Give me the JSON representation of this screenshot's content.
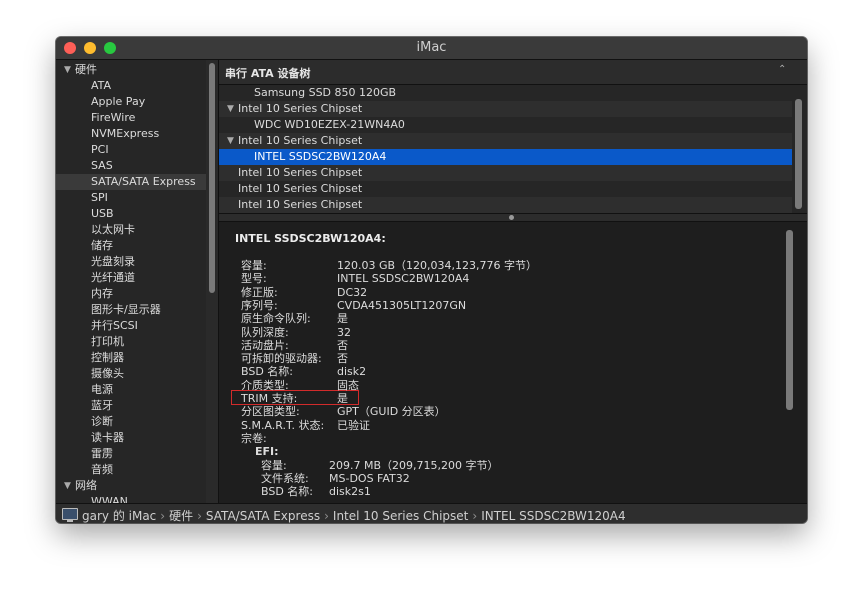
{
  "window": {
    "title": "iMac"
  },
  "sidebar": {
    "groups": [
      {
        "label": "硬件",
        "expanded": true
      },
      {
        "label": "网络",
        "expanded": true
      }
    ],
    "items": [
      "ATA",
      "Apple Pay",
      "FireWire",
      "NVMExpress",
      "PCI",
      "SAS",
      "SATA/SATA Express",
      "SPI",
      "USB",
      "以太网卡",
      "储存",
      "光盘刻录",
      "光纤通道",
      "内存",
      "图形卡/显示器",
      "并行SCSI",
      "打印机",
      "控制器",
      "摄像头",
      "电源",
      "蓝牙",
      "诊断",
      "读卡器",
      "雷雳",
      "音频"
    ],
    "network_items": [
      "WWAN"
    ],
    "selected": "SATA/SATA Express"
  },
  "tree": {
    "header": "串行 ATA 设备树",
    "rows": [
      {
        "label": "Samsung SSD 850 120GB",
        "level": 1,
        "disclosure": false
      },
      {
        "label": "Intel 10 Series Chipset",
        "level": 0,
        "disclosure": true
      },
      {
        "label": "WDC WD10EZEX-21WN4A0",
        "level": 1,
        "disclosure": false
      },
      {
        "label": "Intel 10 Series Chipset",
        "level": 0,
        "disclosure": true
      },
      {
        "label": "INTEL SSDSC2BW120A4",
        "level": 1,
        "disclosure": false,
        "selected": true
      },
      {
        "label": "Intel 10 Series Chipset",
        "level": 0,
        "disclosure": false
      },
      {
        "label": "Intel 10 Series Chipset",
        "level": 0,
        "disclosure": false
      },
      {
        "label": "Intel 10 Series Chipset",
        "level": 0,
        "disclosure": false
      }
    ]
  },
  "detail": {
    "title": "INTEL SSDSC2BW120A4:",
    "props": [
      {
        "k": "容量:",
        "v": "120.03 GB（120,034,123,776 字节）"
      },
      {
        "k": "型号:",
        "v": "INTEL SSDSC2BW120A4"
      },
      {
        "k": "修正版:",
        "v": "DC32"
      },
      {
        "k": "序列号:",
        "v": "CVDA451305LT1207GN"
      },
      {
        "k": "原生命令队列:",
        "v": "是"
      },
      {
        "k": "队列深度:",
        "v": "32"
      },
      {
        "k": "活动盘片:",
        "v": "否"
      },
      {
        "k": "可拆卸的驱动器:",
        "v": "否"
      },
      {
        "k": "BSD 名称:",
        "v": "disk2"
      },
      {
        "k": "介质类型:",
        "v": "固态"
      },
      {
        "k": "TRIM 支持:",
        "v": "是",
        "highlight": true
      },
      {
        "k": "分区图类型:",
        "v": "GPT（GUID 分区表）"
      },
      {
        "k": "S.M.A.R.T. 状态:",
        "v": "已验证"
      },
      {
        "k": "宗卷:",
        "v": ""
      }
    ],
    "volume": {
      "name": "EFI:",
      "props": [
        {
          "k": "容量:",
          "v": "209.7 MB（209,715,200 字节）"
        },
        {
          "k": "文件系统:",
          "v": "MS-DOS FAT32"
        },
        {
          "k": "BSD 名称:",
          "v": "disk2s1"
        }
      ]
    }
  },
  "statusbar": {
    "crumbs": [
      "gary 的 iMac",
      "硬件",
      "SATA/SATA Express",
      "Intel 10 Series Chipset",
      "INTEL SSDSC2BW120A4"
    ],
    "separator": "›"
  },
  "colors": {
    "selection": "#0a59c9",
    "highlight_box": "#d22b2b"
  }
}
